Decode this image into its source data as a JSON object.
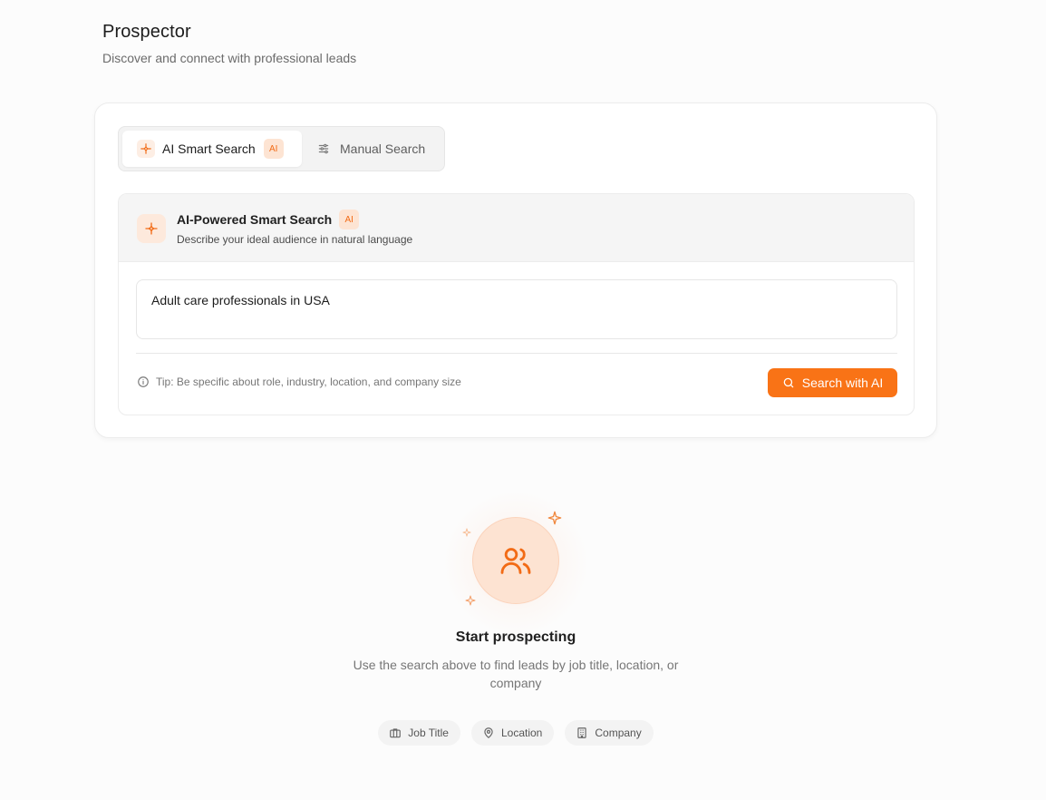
{
  "header": {
    "title": "Prospector",
    "subtitle": "Discover and connect with professional leads"
  },
  "tabs": [
    {
      "label": "AI Smart Search",
      "badge": "AI",
      "active": true
    },
    {
      "label": "Manual Search",
      "active": false
    }
  ],
  "panel": {
    "title": "AI-Powered Smart Search",
    "badge": "AI",
    "description": "Describe your ideal audience in natural language",
    "query_value": "Adult care professionals in USA",
    "tip": "Tip: Be specific about role, industry, location, and company size",
    "search_button": "Search with AI"
  },
  "empty_state": {
    "title": "Start prospecting",
    "description": "Use the search above to find leads by job title, location, or company",
    "chips": [
      "Job Title",
      "Location",
      "Company"
    ]
  },
  "colors": {
    "accent": "#f97316",
    "accent_soft": "#fde4d3"
  },
  "icons": {
    "ai_tab": "sparkles-icon",
    "manual_tab": "sliders-icon",
    "tip": "info-icon",
    "search": "search-icon",
    "empty": "users-icon",
    "chip_job": "briefcase-icon",
    "chip_location": "map-pin-icon",
    "chip_company": "building-icon"
  }
}
